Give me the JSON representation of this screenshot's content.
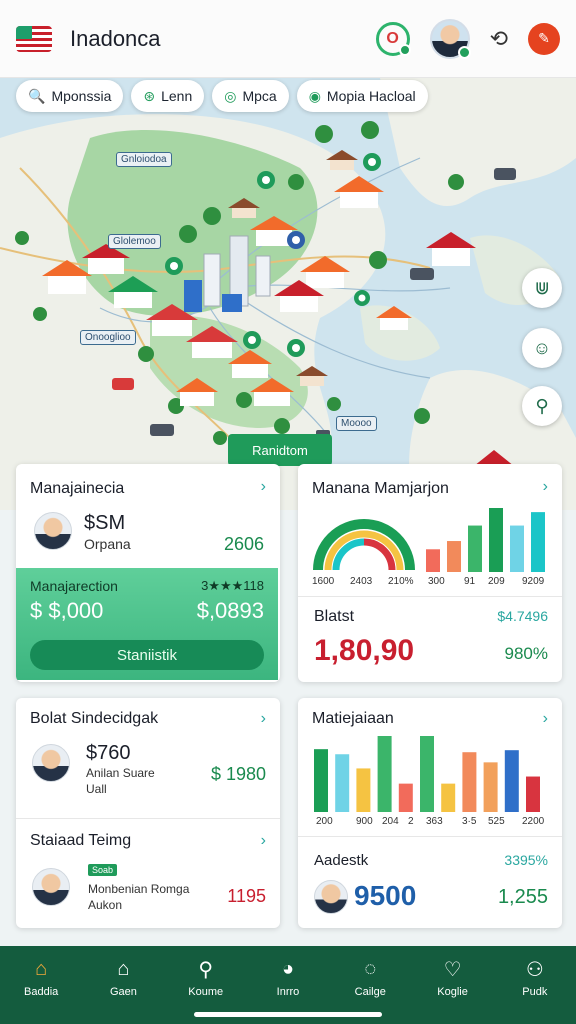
{
  "header": {
    "title": "Inadonca",
    "ring_letter": "O"
  },
  "chips": [
    {
      "icon": "🔍",
      "label": "Mponssia"
    },
    {
      "icon": "⊛",
      "label": "Lenn"
    },
    {
      "icon": "◎",
      "label": "Mpca"
    },
    {
      "icon": "◉",
      "label": "Mopia Hacloal"
    }
  ],
  "map": {
    "labels": [
      "Gnloiodoa",
      "Glolemoo",
      "Onooglioo",
      "Moooo"
    ],
    "banner": "Ranidtom"
  },
  "card1": {
    "title": "Manajainecia",
    "amount": "$SM",
    "sub": "Orpana",
    "value": "2606",
    "green_title": "Manajarection",
    "green_meta": "3★★★118",
    "green_left": "$ $,000",
    "green_right": "$,0893",
    "button": "Staniistik"
  },
  "card2": {
    "title": "Manana Mamjarjon",
    "donut_labels": [
      "1600",
      "2403",
      "210%"
    ],
    "bar_labels": [
      "300",
      "91",
      "209",
      "9209"
    ],
    "bar_values": [
      22,
      30,
      45,
      62,
      45,
      58
    ],
    "bar_colors": [
      "#f26b5b",
      "#f28a5b",
      "#3bb56a",
      "#1a9e55",
      "#6fd3e6",
      "#1bc5c8"
    ],
    "stat_title": "Blatst",
    "stat_meta": "$4.7496",
    "big_value": "1,80,90",
    "pct": "980%"
  },
  "card3": {
    "title": "Bolat Sindecidgak",
    "amount": "$760",
    "sub1": "Anilan Suare",
    "sub2": "Uall",
    "value": "$ 1980"
  },
  "card4": {
    "title": "Staiaad Teimg",
    "badge": "Soab",
    "line1": "Monbenian Romga",
    "line2": "Aukon",
    "value": "1195"
  },
  "card5": {
    "title": "Matiejaiaan",
    "bar_values": [
      62,
      57,
      43,
      75,
      28,
      75,
      28,
      59,
      49,
      61,
      35
    ],
    "bar_colors": [
      "#1a9e55",
      "#6fd3e6",
      "#f5c342",
      "#3bb56a",
      "#f26b5b",
      "#3bb56a",
      "#f5c342",
      "#f28a5b",
      "#f2a05b",
      "#2f6fc9",
      "#d8343f"
    ],
    "axis_labels": [
      "200",
      "900",
      "204",
      "2",
      "363",
      "3·5",
      "525",
      "2200"
    ],
    "foot_title": "Aadestk",
    "foot_meta": "3395%",
    "big_value": "9500",
    "right_value": "1,255"
  },
  "nav": [
    {
      "icon": "⌂",
      "label": "Baddia"
    },
    {
      "icon": "⌂",
      "label": "Gaen"
    },
    {
      "icon": "⚲",
      "label": "Koume"
    },
    {
      "icon": "◕",
      "label": "Inrro"
    },
    {
      "icon": "◌",
      "label": "Cailge"
    },
    {
      "icon": "♡",
      "label": "Koglie"
    },
    {
      "icon": "⚇",
      "label": "Pudk"
    }
  ]
}
